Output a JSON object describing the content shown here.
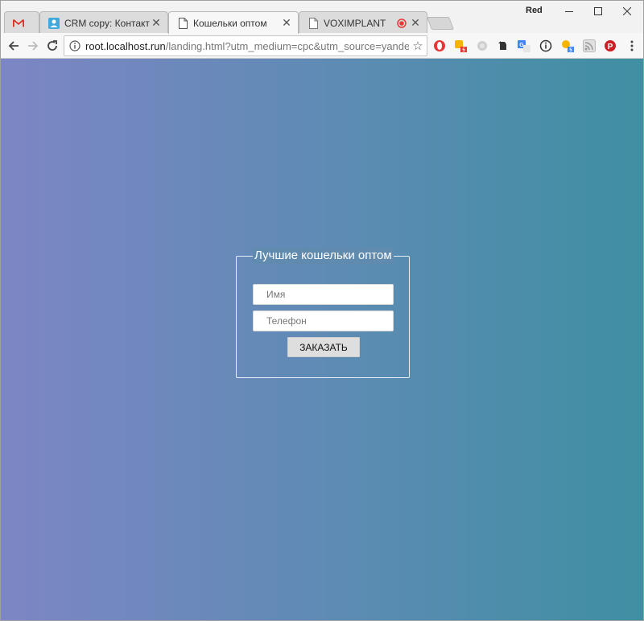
{
  "browser": {
    "profile_name": "Red",
    "tabs": [
      {
        "title": "",
        "icon": "gmail-icon",
        "active": false
      },
      {
        "title": "CRM copy: Контакты - A",
        "icon": "crm-icon",
        "active": false
      },
      {
        "title": "Кошельки оптом",
        "icon": "page-icon",
        "active": true
      },
      {
        "title": "VOXIMPLANT",
        "icon": "page-icon",
        "active": false,
        "recording": true
      }
    ],
    "address": {
      "host": "root.localhost.run",
      "path": "/landing.html?utm_medium=cpc&utm_source=yandex&ut..."
    },
    "extensions": [
      {
        "name": "opera-icon"
      },
      {
        "name": "extension-badge-icon",
        "badge": "5"
      },
      {
        "name": "grey-extension-icon"
      },
      {
        "name": "evernote-icon"
      },
      {
        "name": "translate-icon"
      },
      {
        "name": "info-circle-icon"
      },
      {
        "name": "extension-badge-blue-icon",
        "badge": "5"
      },
      {
        "name": "rss-icon"
      },
      {
        "name": "pinterest-icon"
      },
      {
        "name": "menu-icon"
      }
    ]
  },
  "form": {
    "legend": "Лучшие кошельки оптом",
    "name_placeholder": "Имя",
    "phone_placeholder": "Телефон",
    "submit_label": "ЗАКАЗАТЬ"
  },
  "colors": {
    "gradient_start": "#7d86c4",
    "gradient_end": "#3f8fa2"
  }
}
